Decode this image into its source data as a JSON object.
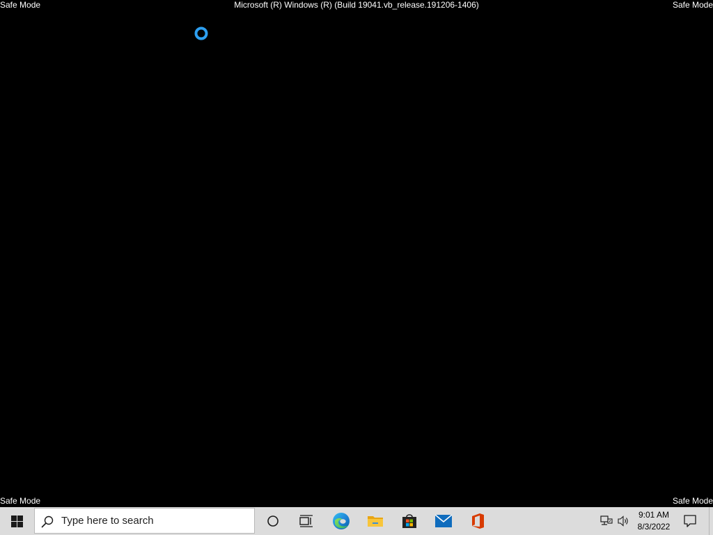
{
  "screen": {
    "watermark": {
      "top_left": "Safe Mode",
      "top_right": "Safe Mode",
      "bottom_left": "Safe Mode",
      "bottom_right": "Safe Mode",
      "build": "Microsoft (R) Windows (R) (Build 19041.vb_release.191206-1406)"
    },
    "busy_cursor_color": "#2d9ff0"
  },
  "taskbar": {
    "background": "#dcdcdc",
    "start_icon": "windows-logo-icon",
    "search": {
      "placeholder": "Type here to search",
      "value": "",
      "icon": "search-icon"
    },
    "pinned": [
      {
        "name": "Cortana",
        "icon": "cortana-icon"
      },
      {
        "name": "Task View",
        "icon": "task-view-icon"
      },
      {
        "name": "Microsoft Edge",
        "icon": "edge-icon"
      },
      {
        "name": "File Explorer",
        "icon": "folder-icon"
      },
      {
        "name": "Microsoft Store",
        "icon": "store-icon"
      },
      {
        "name": "Mail",
        "icon": "mail-icon"
      },
      {
        "name": "Office",
        "icon": "office-icon"
      }
    ],
    "tray": {
      "network_icon": "network-icon",
      "volume_icon": "volume-icon",
      "time": "9:01 AM",
      "date": "8/3/2022",
      "notification_icon": "action-center-icon"
    }
  }
}
